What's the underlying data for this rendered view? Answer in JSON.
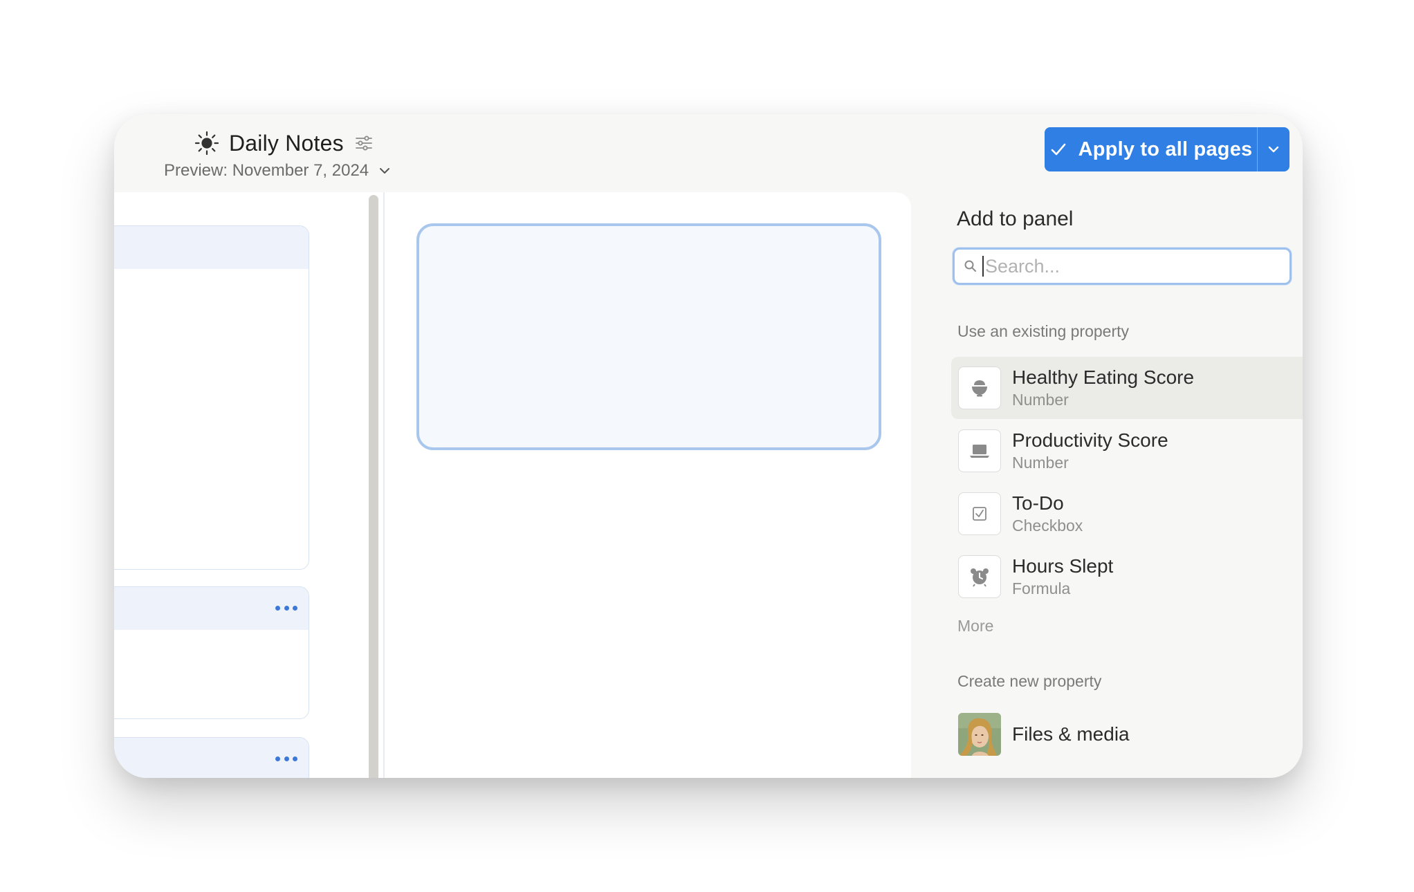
{
  "header": {
    "title": "Daily Notes",
    "preview_label": "Preview: November 7, 2024",
    "apply_button_label": "Apply to all pages"
  },
  "panel": {
    "title": "Add to panel",
    "search_placeholder": "Search...",
    "existing_section_label": "Use an existing property",
    "properties": [
      {
        "name": "Healthy Eating Score",
        "type": "Number",
        "icon": "bowl-icon"
      },
      {
        "name": "Productivity Score",
        "type": "Number",
        "icon": "laptop-icon"
      },
      {
        "name": "To-Do",
        "type": "Checkbox",
        "icon": "checkbox-icon"
      },
      {
        "name": "Hours Slept",
        "type": "Formula",
        "icon": "alarm-clock-icon"
      }
    ],
    "more_label": "More",
    "create_section_label": "Create new property",
    "create_items": [
      {
        "name": "Files & media",
        "icon": "painting-thumbnail"
      }
    ]
  },
  "colors": {
    "accent": "#2f7fe4",
    "drop_zone_border": "#a9c6ec",
    "panel_bg": "#f7f7f5"
  }
}
